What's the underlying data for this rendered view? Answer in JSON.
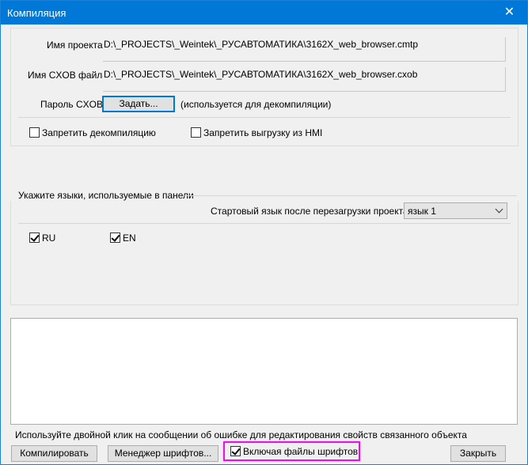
{
  "window": {
    "title": "Компиляция",
    "close_glyph": "✕"
  },
  "project": {
    "name_label": "Имя проекта:",
    "name_value": "D:\\_PROJECTS\\_Weintek\\_РУСАВТОМАТИКА\\3162X_web_browser.cmtp",
    "cxob_label": "Имя CXOB файла:",
    "cxob_value": "D:\\_PROJECTS\\_Weintek\\_РУСАВТОМАТИКА\\3162X_web_browser.cxob",
    "password_label": "Пароль CXOB:",
    "password_button": "Задать...",
    "password_hint": "(используется для декомпиляции)",
    "deny_decompile": {
      "label": "Запретить декомпиляцию",
      "checked": false
    },
    "deny_upload": {
      "label": "Запретить выгрузку из HMI",
      "checked": false
    }
  },
  "languages": {
    "group_title": "Укажите языки, используемые в панели",
    "startup_label": "Стартовый язык после перезагрузки проекта:",
    "startup_value": "язык 1",
    "items": [
      {
        "label": "RU",
        "checked": true
      },
      {
        "label": "EN",
        "checked": true
      }
    ]
  },
  "footer": {
    "hint": "Используйте двойной клик на сообщении об ошибке для редактирования свойств связанного объекта",
    "compile_button": "Компилировать",
    "font_manager_button": "Менеджер шрифтов...",
    "include_fonts": {
      "label": "Включая файлы шрифтов",
      "checked": true
    },
    "close_button": "Закрыть"
  },
  "colors": {
    "titlebar": "#0078d7",
    "highlight": "#ff00ff"
  }
}
